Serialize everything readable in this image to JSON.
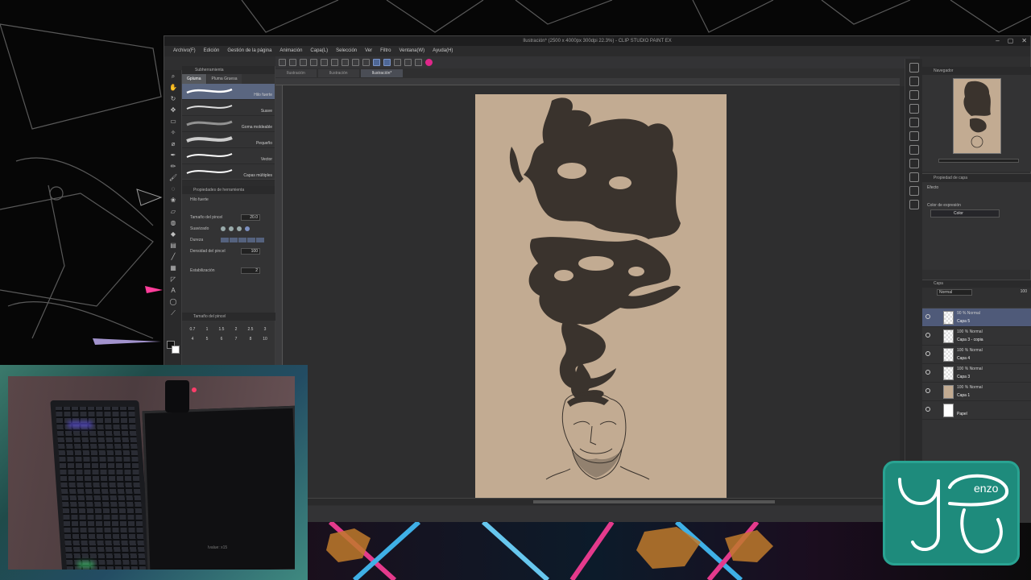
{
  "window": {
    "title": "Ilustración* (2500 x 4000px 300dpi 22.3%)  - CLIP STUDIO PAINT EX",
    "controls": [
      "–",
      "▢",
      "✕"
    ]
  },
  "menu": [
    "Archivo(F)",
    "Edición",
    "Gestión de la página",
    "Animación",
    "Capa(L)",
    "Selección",
    "Ver",
    "Filtro",
    "Ventana(W)",
    "Ayuda(H)"
  ],
  "doc_tabs": [
    "Ilustración",
    "Ilustración",
    "Ilustración*"
  ],
  "brush_panel": {
    "header": "Subherramienta",
    "tabs": [
      "Gpluma",
      "Pluma Gruesa"
    ],
    "brushes": [
      "Hilo fuerte",
      "Suave",
      "Goma moldeable",
      "Pequeño",
      "Vector",
      "Capas múltiples"
    ],
    "selected_brush": "Hilo fuerte",
    "props_header": "Propiedades de herramienta",
    "props_tool": "Hilo fuerte",
    "props": [
      {
        "label": "Tamaño del pincel",
        "value": "20.0"
      },
      {
        "label": "Suavizado",
        "value": ""
      },
      {
        "label": "Dureza",
        "value": ""
      },
      {
        "label": "Densidad del pincel",
        "value": "100"
      },
      {
        "label": "Estabilización",
        "value": "2"
      }
    ],
    "size_header": "Tamaño del pincel",
    "sizes": [
      "0.7",
      "1",
      "1.5",
      "2",
      "2.5",
      "3",
      "4",
      "5",
      "6",
      "7",
      "8",
      "10"
    ]
  },
  "navigator": {
    "title": "Navegador"
  },
  "layer_props": {
    "title": "Propiedad de capa",
    "effect_label": "Efecto",
    "expr_label": "Color de expresión",
    "expr_value": "Color"
  },
  "layers": {
    "title": "Capa",
    "blend": "Normal",
    "opacity": "100",
    "items": [
      {
        "mode": "90 % Normal",
        "name": "Capa 5",
        "thumb": "check"
      },
      {
        "mode": "100 % Normal",
        "name": "Capa 3 - copia",
        "thumb": "check"
      },
      {
        "mode": "100 % Normal",
        "name": "Capa 4",
        "thumb": "check"
      },
      {
        "mode": "100 % Normal",
        "name": "Capa 3",
        "thumb": "check"
      },
      {
        "mode": "100 % Normal",
        "name": "Capa 1",
        "thumb": "tan"
      },
      {
        "mode": "",
        "name": "Papel",
        "thumb": "white"
      }
    ]
  },
  "webcam": {
    "brand": "Ivalue: x15"
  },
  "logo": {
    "text": "Y enzo"
  },
  "colors": {
    "paper": "#c2ab92",
    "ink": "#3a332d",
    "accent_selection": "#4f5a79",
    "logo_bg": "#1e8b7c"
  }
}
